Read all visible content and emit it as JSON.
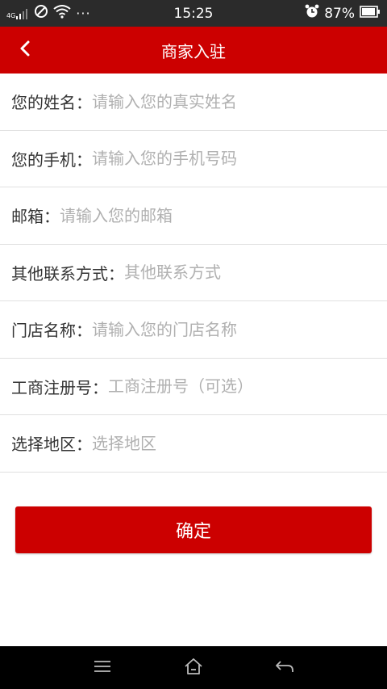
{
  "status_bar": {
    "network": "4G",
    "time": "15:25",
    "battery": "87%",
    "more": "···"
  },
  "header": {
    "title": "商家入驻"
  },
  "form": {
    "rows": [
      {
        "label": "您的姓名：",
        "placeholder": "请输入您的真实姓名"
      },
      {
        "label": "您的手机：",
        "placeholder": "请输入您的手机号码"
      },
      {
        "label": "邮箱：",
        "placeholder": "请输入您的邮箱"
      },
      {
        "label": "其他联系方式：",
        "placeholder": "其他联系方式"
      },
      {
        "label": "门店名称：",
        "placeholder": "请输入您的门店名称"
      },
      {
        "label": "工商注册号：",
        "placeholder": "工商注册号（可选）"
      },
      {
        "label": "选择地区：",
        "placeholder": "选择地区"
      }
    ]
  },
  "confirm_button": {
    "label": "确定"
  },
  "colors": {
    "brand": "#cc0000",
    "status_bar": "#2b2b2b",
    "nav_bar": "#000000",
    "placeholder": "#b0b0b0"
  },
  "icons": {
    "back": "chevron-left-icon",
    "menu": "menu-icon",
    "home": "home-icon",
    "return": "return-icon"
  }
}
